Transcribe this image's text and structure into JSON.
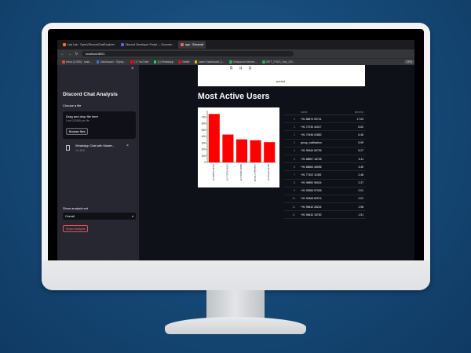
{
  "browser": {
    "tabs": [
      {
        "label": "Lab Lab · SyneVDiscordChatExplorer"
      },
      {
        "label": "Discord Developer Portal — Docume..."
      },
      {
        "label": "app · Streamlit",
        "active": true
      }
    ],
    "address": "localhost:8501",
    "bookmarks": [
      {
        "label": "Inbox (3,555) · kash...",
        "color": "#ea4335"
      },
      {
        "label": "Dashboard · Olymp...",
        "color": "#4b6bd8"
      },
      {
        "label": "(7) YouTube",
        "color": "#ff0000"
      },
      {
        "label": "(1) WhatsApp",
        "color": "#25d366"
      },
      {
        "label": "Netflix",
        "color": "#e50914"
      },
      {
        "label": "Learn Dashboard | L...",
        "color": "#f4b400"
      },
      {
        "label": "Bollywood Movies ...",
        "color": "#34a853"
      },
      {
        "label": "IBFT_FSDS_Sep_202...",
        "color": "#34a853"
      }
    ],
    "profile": "VPN"
  },
  "sidebar": {
    "title": "Discord Chat Analysis",
    "choose_file_label": "Choose a file",
    "dropzone_title": "Drag and drop file here",
    "dropzone_sub": "Limit 200MB per file",
    "browse_label": "Browse files",
    "file_name": "WhatsApp Chat with Master...",
    "file_size": "111.8KB",
    "analysis_label": "Show analysis wrt",
    "analysis_value": "Overall",
    "show_button": "Show Analysis"
  },
  "main": {
    "prev_ticks": [
      "10",
      "11",
      "12"
    ],
    "prev_xlabel": "period",
    "section_title": "Most Active Users"
  },
  "chart_data": {
    "type": "bar",
    "title": "",
    "categories": [
      "+91 88873 09741",
      "+91 73730 42017",
      "+91 79196 02882",
      "group_notification",
      "+91 95160 69739"
    ],
    "values": [
      748,
      430,
      356,
      342,
      313
    ],
    "ylim": [
      0,
      800
    ],
    "yticks": [
      0,
      100,
      200,
      300,
      400,
      500,
      600,
      700
    ],
    "bar_color": "#ff0000"
  },
  "table": {
    "headers": [
      "",
      "name",
      "percent"
    ],
    "rows": [
      [
        "0",
        "+91 88873 09741",
        "17.63"
      ],
      [
        "1",
        "+91 73730 42017",
        "8.62"
      ],
      [
        "2",
        "+91 79196 02882",
        "6.45"
      ],
      [
        "3",
        "group_notification",
        "5.99"
      ],
      [
        "4",
        "+91 95160 69739",
        "5.27"
      ],
      [
        "5",
        "+91 88897 18728",
        "5.11"
      ],
      [
        "6",
        "+91 86664 46096",
        "4.49"
      ],
      [
        "7",
        "+91 77402 11083",
        "2.48"
      ],
      [
        "8",
        "+91 96890 96024",
        "2.27"
      ],
      [
        "9",
        "+91 95355 57006",
        "2.01"
      ],
      [
        "10",
        "+91 99468 82974",
        "2.01"
      ],
      [
        "11",
        "+91 96610 28224",
        "1.98"
      ],
      [
        "12",
        "+91 96610 15782",
        "1.51"
      ]
    ]
  }
}
